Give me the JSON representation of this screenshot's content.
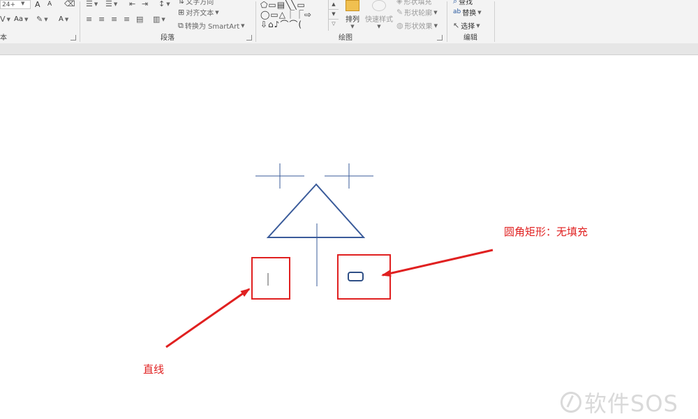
{
  "ribbon": {
    "font_group": {
      "label": "本",
      "font_size": "24+",
      "grow_label": "A",
      "shrink_label": "A",
      "case_label": "Aa",
      "color_label": "A"
    },
    "paragraph_group": {
      "label": "段落",
      "text_direction": "文字方向",
      "align_text": "对齐文本",
      "convert_smartart": "转换为 SmartArt"
    },
    "drawing_group": {
      "label": "绘图",
      "shape_rows": [
        "⬠▭▤╲╲▭",
        "◯▭△⎾⎾⇨",
        "⇩⌂♪⌒⌒("
      ],
      "arrange_label": "排列",
      "quick_styles_label": "快速样式",
      "shape_fill": "形状填充",
      "shape_outline": "形状轮廓",
      "shape_effects": "形状效果"
    },
    "editing_group": {
      "label": "编辑",
      "find": "查找",
      "replace": "替换",
      "select": "选择"
    }
  },
  "annotations": {
    "rounded_rect_label": "圆角矩形：无填充",
    "line_label": "直线"
  },
  "watermark": {
    "text": "软件SOS"
  },
  "colors": {
    "shape_stroke": "#3a5b9a",
    "annotation_red": "#e02020",
    "ribbon_bg": "#f3f3f3"
  }
}
